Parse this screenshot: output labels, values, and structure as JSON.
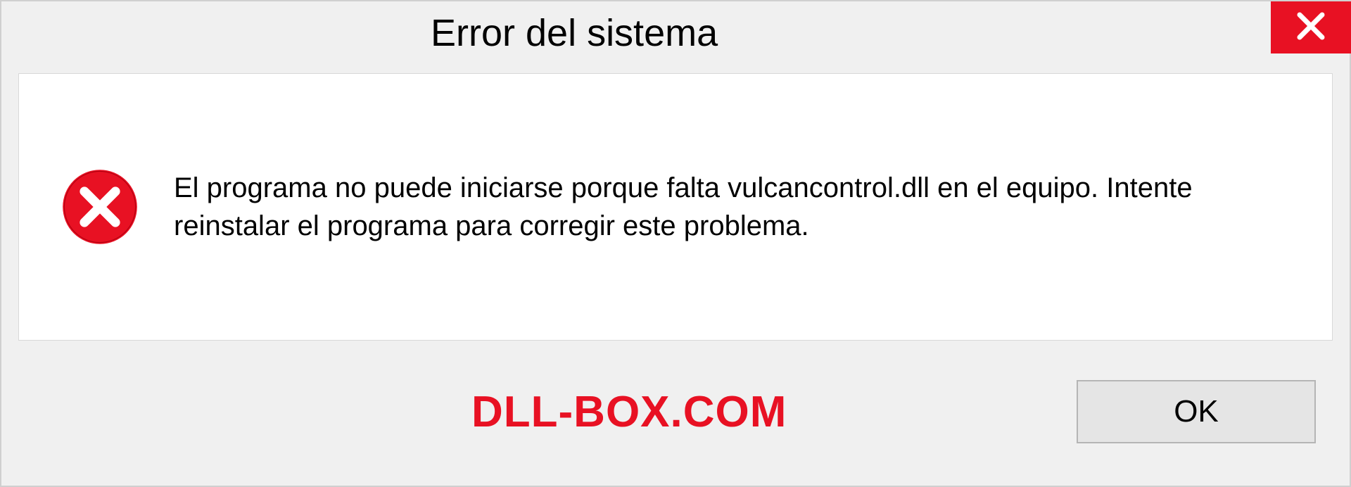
{
  "dialog": {
    "title": "Error del sistema",
    "message": "El programa no puede iniciarse porque falta vulcancontrol.dll en el equipo. Intente reinstalar el programa para corregir este problema.",
    "ok_label": "OK"
  },
  "watermark": "DLL-BOX.COM"
}
